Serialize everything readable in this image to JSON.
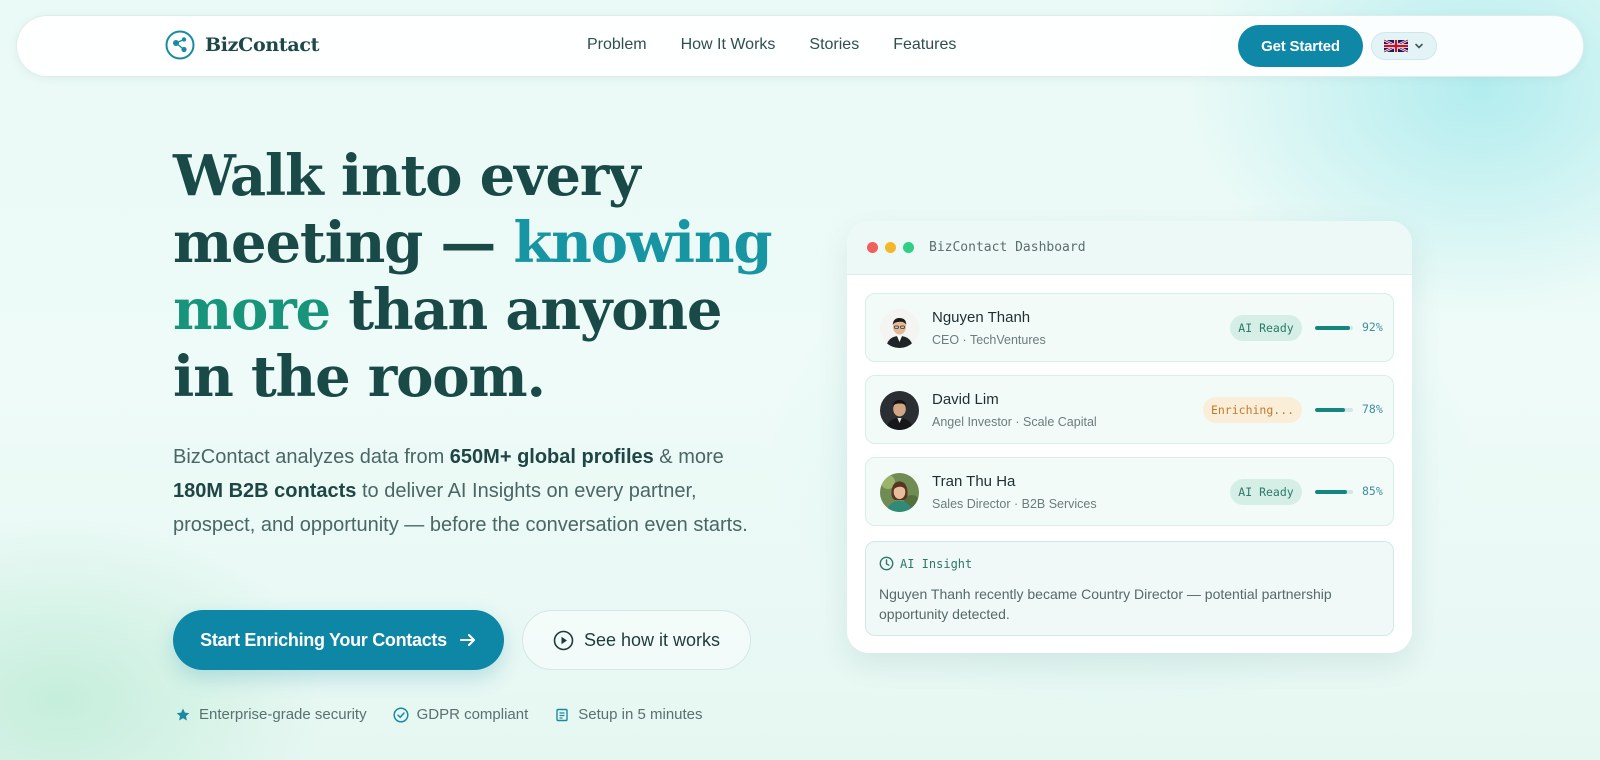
{
  "nav": {
    "brand": "BizContact",
    "links": [
      "Problem",
      "How It Works",
      "Stories",
      "Features"
    ],
    "cta": "Get Started",
    "language_icon": "uk-flag-icon"
  },
  "hero": {
    "headline_1": "Walk into every meeting — ",
    "headline_accent_1": "knowing",
    "headline_accent_2": "more",
    "headline_2": " than anyone in the room.",
    "sub_1": "BizContact analyzes data from ",
    "sub_bold_1": "650M+ global profiles",
    "sub_2": " & more ",
    "sub_bold_2": "180M B2B contacts",
    "sub_3": " to deliver AI Insights on every partner, prospect, and opportunity — before the conversation even starts.",
    "primary_cta": "Start Enriching Your Contacts",
    "secondary_cta": "See how it works",
    "trust": [
      {
        "icon": "star-icon",
        "label": "Enterprise-grade security"
      },
      {
        "icon": "check-circle-icon",
        "label": "GDPR compliant"
      },
      {
        "icon": "document-icon",
        "label": "Setup in 5 minutes"
      }
    ]
  },
  "dashboard": {
    "title": "BizContact Dashboard",
    "contacts": [
      {
        "name": "Nguyen Thanh",
        "role": "CEO · TechVentures",
        "status": "AI Ready",
        "status_type": "ready",
        "progress": 0.92,
        "progress_label": "92%"
      },
      {
        "name": "David Lim",
        "role": "Angel Investor · Scale Capital",
        "status": "Enriching...",
        "status_type": "enrich",
        "progress": 0.78,
        "progress_label": "78%"
      },
      {
        "name": "Tran Thu Ha",
        "role": "Sales Director · B2B Services",
        "status": "AI Ready",
        "status_type": "ready",
        "progress": 0.85,
        "progress_label": "85%"
      }
    ],
    "insight_label": "AI Insight",
    "insight_text": "Nguyen Thanh recently became Country Director — potential partnership opportunity detected."
  },
  "colors": {
    "accent": "#0f87a7",
    "headline": "#194a48",
    "accent_teal": "#1795a2",
    "accent_green": "#17947a",
    "dot_red": "#f0605a",
    "dot_yellow": "#f4b62a",
    "dot_green": "#2fcf87"
  }
}
